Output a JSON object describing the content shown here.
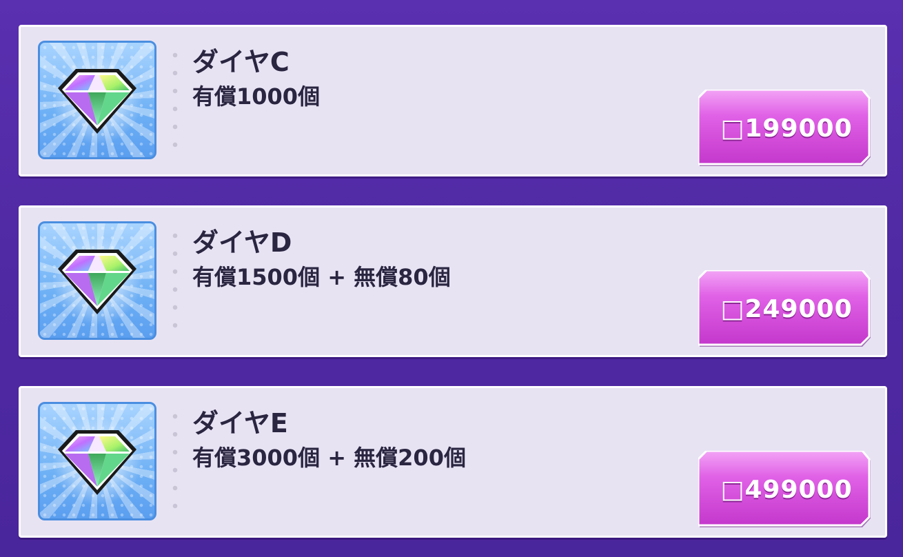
{
  "items": [
    {
      "name": "ダイヤC",
      "description": "有償1000個",
      "price": "□199000",
      "icon": "rainbow-diamond-icon"
    },
    {
      "name": "ダイヤD",
      "description": "有償1500個 + 無償80個",
      "price": "□249000",
      "icon": "rainbow-diamond-icon"
    },
    {
      "name": "ダイヤE",
      "description": "有償3000個 + 無償200個",
      "price": "□499000",
      "icon": "rainbow-diamond-icon"
    }
  ],
  "colors": {
    "background": "#5a2fb0",
    "card": "#e8e3f3",
    "button": "#d34fd6",
    "text": "#2a2540"
  }
}
